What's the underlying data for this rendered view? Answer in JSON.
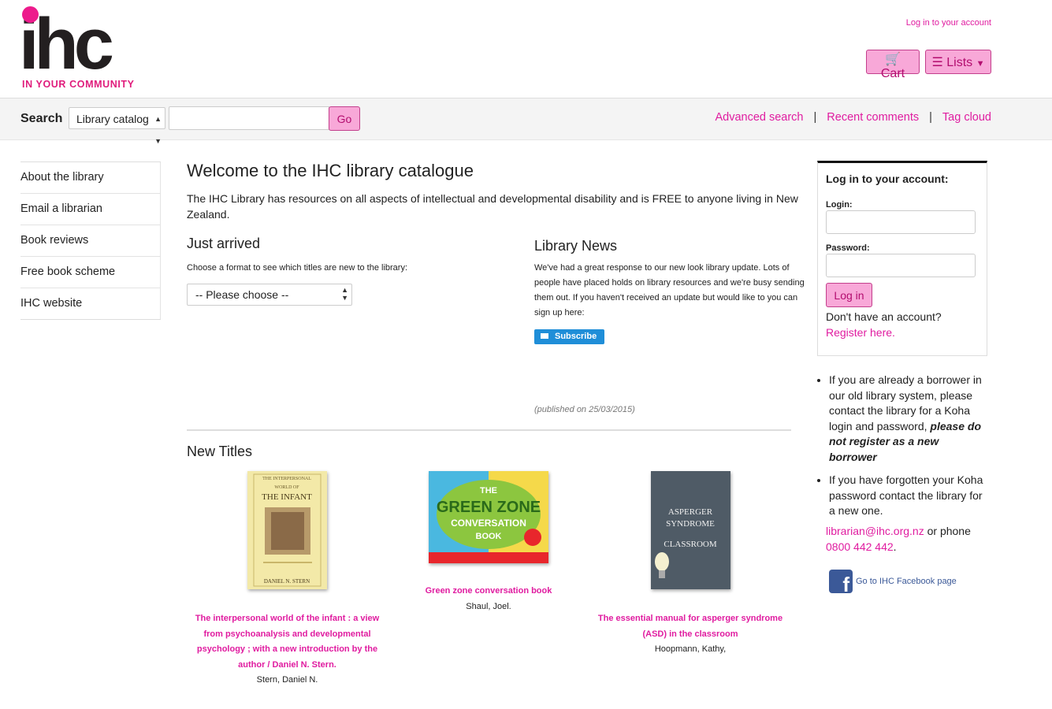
{
  "logo": {
    "text": "ihc",
    "tagline": "IN YOUR COMMUNITY"
  },
  "header": {
    "login_link": "Log in to your account",
    "cart_label": "Cart",
    "lists_label": "Lists"
  },
  "search": {
    "label": "Search",
    "scope": "Library catalog",
    "go_label": "Go",
    "links": [
      "Advanced search",
      "Recent comments",
      "Tag cloud"
    ]
  },
  "sidebar": {
    "items": [
      "About the library",
      "Email a librarian",
      "Book reviews",
      "Free book scheme",
      "IHC website"
    ]
  },
  "main": {
    "title": "Welcome to the IHC library catalogue",
    "intro": "The IHC Library has resources on all aspects of intellectual and developmental disability and is FREE to anyone living in New Zealand.",
    "just_arrived": {
      "title": "Just arrived",
      "text": "Choose a format to see which titles are new to the library:",
      "select_value": "-- Please choose --"
    },
    "news": {
      "title": "Library News",
      "text": "We've had  a great response to our new look library update. Lots of people have placed holds on library resources and we're busy sending them out. If you haven't received an update but would like to you can sign up here:",
      "subscribe_label": "Subscribe",
      "published": "(published on 25/03/2015)"
    },
    "new_titles": {
      "title": "New Titles",
      "books": [
        {
          "title": "The interpersonal world of the infant : a view from psychoanalysis and developmental psychology ; with a new introduction by the author / Daniel N. Stern.",
          "author": "Stern, Daniel N.",
          "cover_lines": [
            "THE INTERPERSONAL",
            "WORLD OF",
            "THE INFANT",
            "DANIEL N. STERN"
          ]
        },
        {
          "title": "Green zone conversation book",
          "author": "Shaul, Joel.",
          "cover_lines": [
            "THE",
            "GREEN ZONE",
            "CONVERSATION",
            "BOOK"
          ]
        },
        {
          "title": "The essential manual for asperger syndrome (ASD) in the classroom",
          "author": "Hoopmann, Kathy,",
          "cover_lines": [
            "ASPERGER",
            "SYNDROME",
            "CLASSROOM"
          ]
        }
      ]
    }
  },
  "login": {
    "heading": "Log in to your account:",
    "login_label": "Login:",
    "password_label": "Password:",
    "button": "Log in",
    "no_account": "Don't have an account?",
    "register": "Register here."
  },
  "notes": {
    "note1_text": "If you are already a borrower in our old library system, please contact the library for a Koha login and password,",
    "note1_em": "please do not register as a new borrower",
    "note2": "If you have forgotten your Koha password contact the library for a new one.",
    "email": "librarian@ihc.org.nz",
    "or_phone": " or phone",
    "phone": "0800 442 442",
    "period": "."
  },
  "facebook": {
    "label": "Go to IHC Facebook page"
  },
  "colors": {
    "accent": "#e01ca0",
    "button_bg": "#f8a8d8",
    "facebook": "#3b5998"
  }
}
